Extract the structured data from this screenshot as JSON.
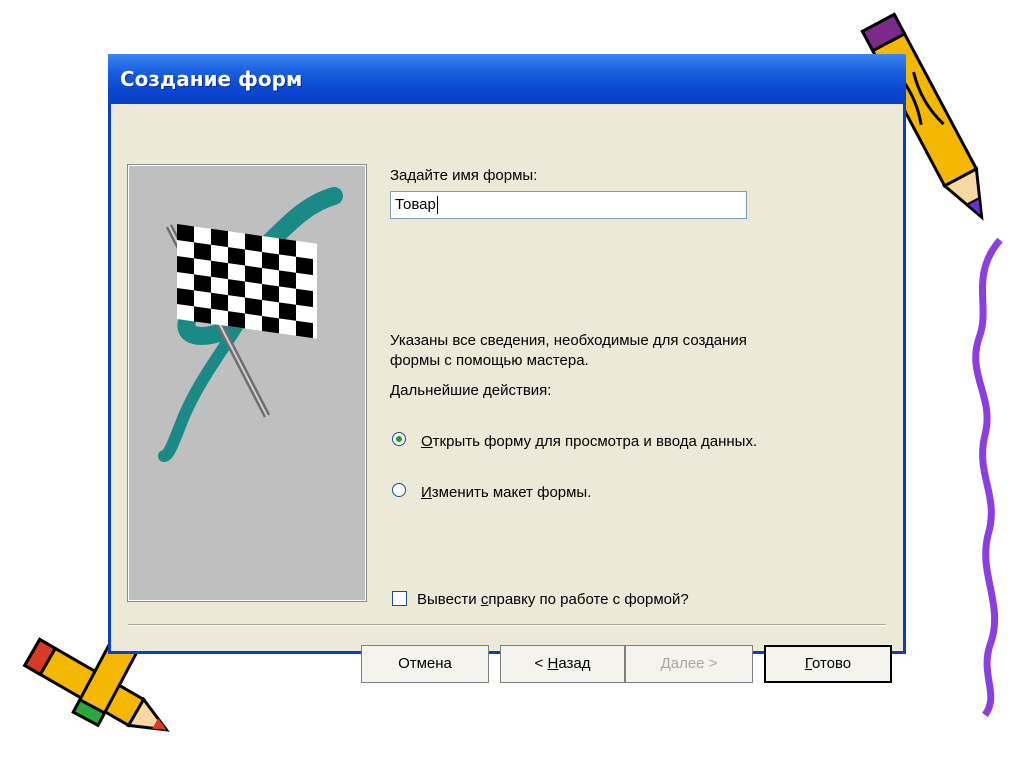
{
  "dialog": {
    "title": "Создание форм",
    "name_prompt": "Задайте имя формы:",
    "form_name_value": "Товар",
    "info_line1": "Указаны все сведения, необходимые для создания",
    "info_line2": "формы с помощью мастера.",
    "next_actions": "Дальнейшие действия:",
    "options": [
      {
        "accel": "О",
        "rest": "ткрыть форму для просмотра и ввода данных.",
        "selected": true
      },
      {
        "accel": "И",
        "rest": "зменить макет формы.",
        "selected": false
      }
    ],
    "help_checkbox": {
      "pre": "Вывести ",
      "accel": "с",
      "post": "правку по работе с формой?",
      "checked": false
    },
    "buttons": {
      "cancel": "Отмена",
      "back_pre": "< ",
      "back_accel": "Н",
      "back_post": "азад",
      "next": "Далее >",
      "finish_accel": "Г",
      "finish_post": "отово"
    }
  },
  "colors": {
    "titlebar": "#0a3fc4",
    "dialog_bg": "#ece9d8",
    "picture_bg": "#bfbfbf",
    "teal_stroke": "#1b8a87",
    "pencil_yellow": "#f5b800",
    "squiggle": "#8b3fe0"
  },
  "icons": [
    "checkered-flag-icon",
    "pencil-decoration-icon",
    "squiggle-decoration-icon"
  ]
}
